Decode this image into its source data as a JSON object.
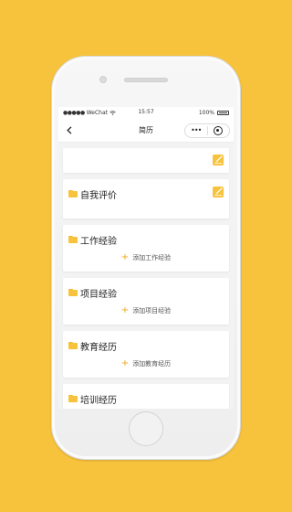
{
  "statusbar": {
    "carrier": "WeChat",
    "time": "15:57",
    "battery": "100%"
  },
  "navbar": {
    "title": "简历",
    "more_label": "•••"
  },
  "colors": {
    "background": "#F8C33C",
    "accent": "#F8C33C",
    "plus": "#F2A71A"
  },
  "icons": {
    "back": "chevron-left-icon",
    "folder": "folder-icon",
    "edit": "edit-icon",
    "close": "target-circle-icon",
    "plus": "plus-icon"
  },
  "sections": [
    {
      "title": "自我评价"
    },
    {
      "title": "工作经验",
      "add_label": "添加工作经验"
    },
    {
      "title": "项目经验",
      "add_label": "添加项目经验"
    },
    {
      "title": "教育经历",
      "add_label": "添加教育经历"
    },
    {
      "title": "培训经历"
    }
  ],
  "plus_symbol": "+"
}
